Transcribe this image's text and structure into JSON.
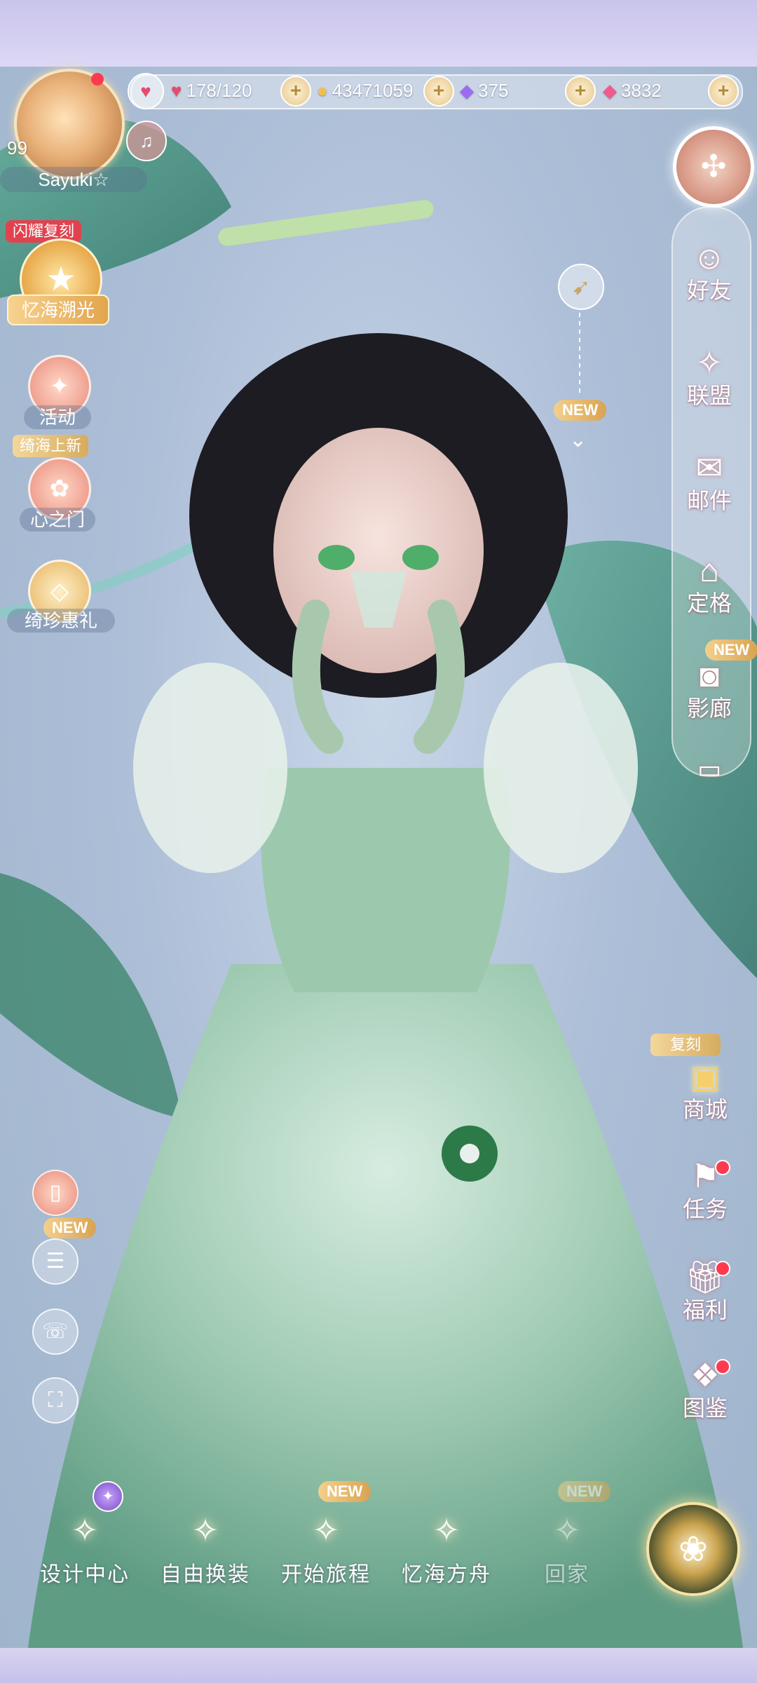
{
  "player": {
    "level": "99",
    "name": "Sayuki☆"
  },
  "resources": {
    "stamina": "178/120",
    "gold": "43471059",
    "diamonds": "375",
    "pink_crystals": "3832"
  },
  "left_menu": {
    "event_tag": "闪耀复刻",
    "event_banner": "忆海溯光",
    "activity_label": "活动",
    "new_tag": "绮海上新",
    "heart_gate_label": "心之门",
    "treasure_label": "绮珍惠礼"
  },
  "right_menu": {
    "friends": "好友",
    "alliance": "联盟",
    "mail": "邮件",
    "pose": "定格",
    "gallery": "影廊",
    "gallery_badge": "NEW",
    "shop_tag": "复刻",
    "shop": "商城",
    "tasks": "任务",
    "welfare": "福利",
    "codex": "图鉴"
  },
  "center": {
    "new_badge": "NEW"
  },
  "tools": {
    "new_badge": "NEW"
  },
  "bottom_nav": {
    "items": [
      {
        "label": "设计中心"
      },
      {
        "label": "自由换装"
      },
      {
        "label": "开始旅程",
        "badge": "NEW"
      },
      {
        "label": "忆海方舟"
      },
      {
        "label": "回家",
        "badge": "NEW"
      }
    ]
  },
  "colors": {
    "accent_gold": "#e2b86a",
    "badge_red": "#e0434f",
    "dress_green": "#8fbf9a"
  }
}
